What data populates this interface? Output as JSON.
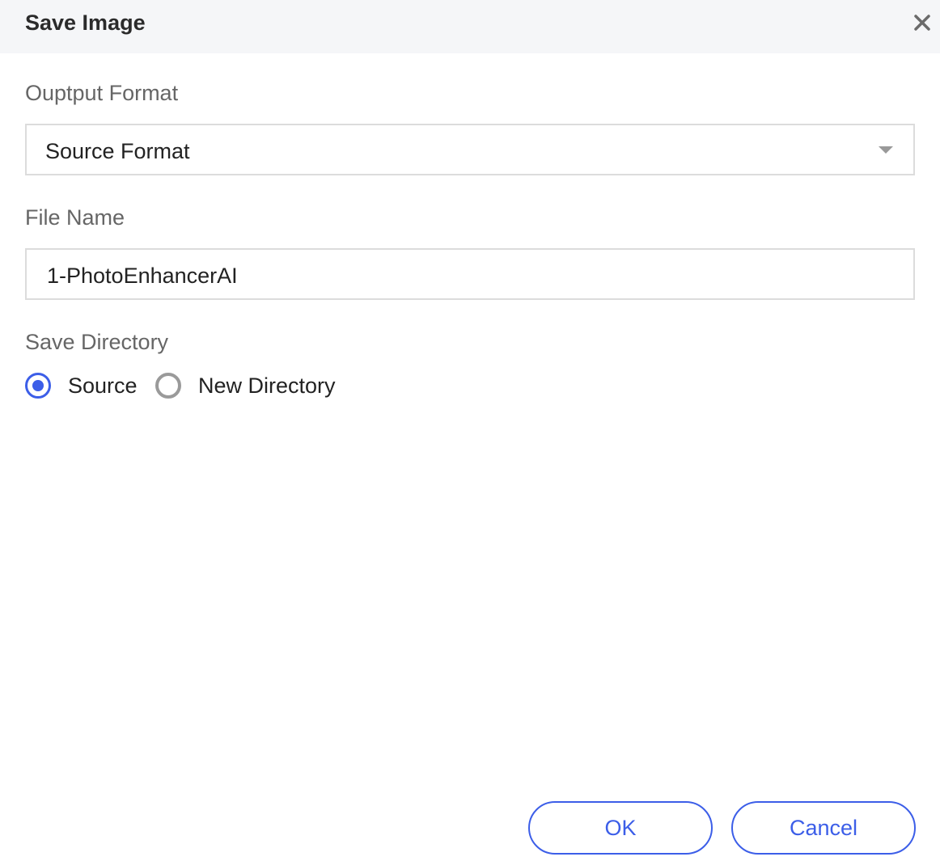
{
  "dialog": {
    "title": "Save Image",
    "close_icon": "close-icon"
  },
  "output_format": {
    "label": "Ouptput Format",
    "selected": "Source Format",
    "dropdown_icon": "chevron-down-icon"
  },
  "file_name": {
    "label": "File Name",
    "value": "1-PhotoEnhancerAI"
  },
  "save_directory": {
    "label": "Save Directory",
    "options": [
      {
        "label": "Source",
        "checked": true
      },
      {
        "label": "New Directory",
        "checked": false
      }
    ]
  },
  "buttons": {
    "ok": "OK",
    "cancel": "Cancel"
  },
  "colors": {
    "accent": "#3c5ee8",
    "titlebar_bg": "#f5f6f8",
    "label_text": "#666666",
    "field_border": "#dcdcdc"
  }
}
